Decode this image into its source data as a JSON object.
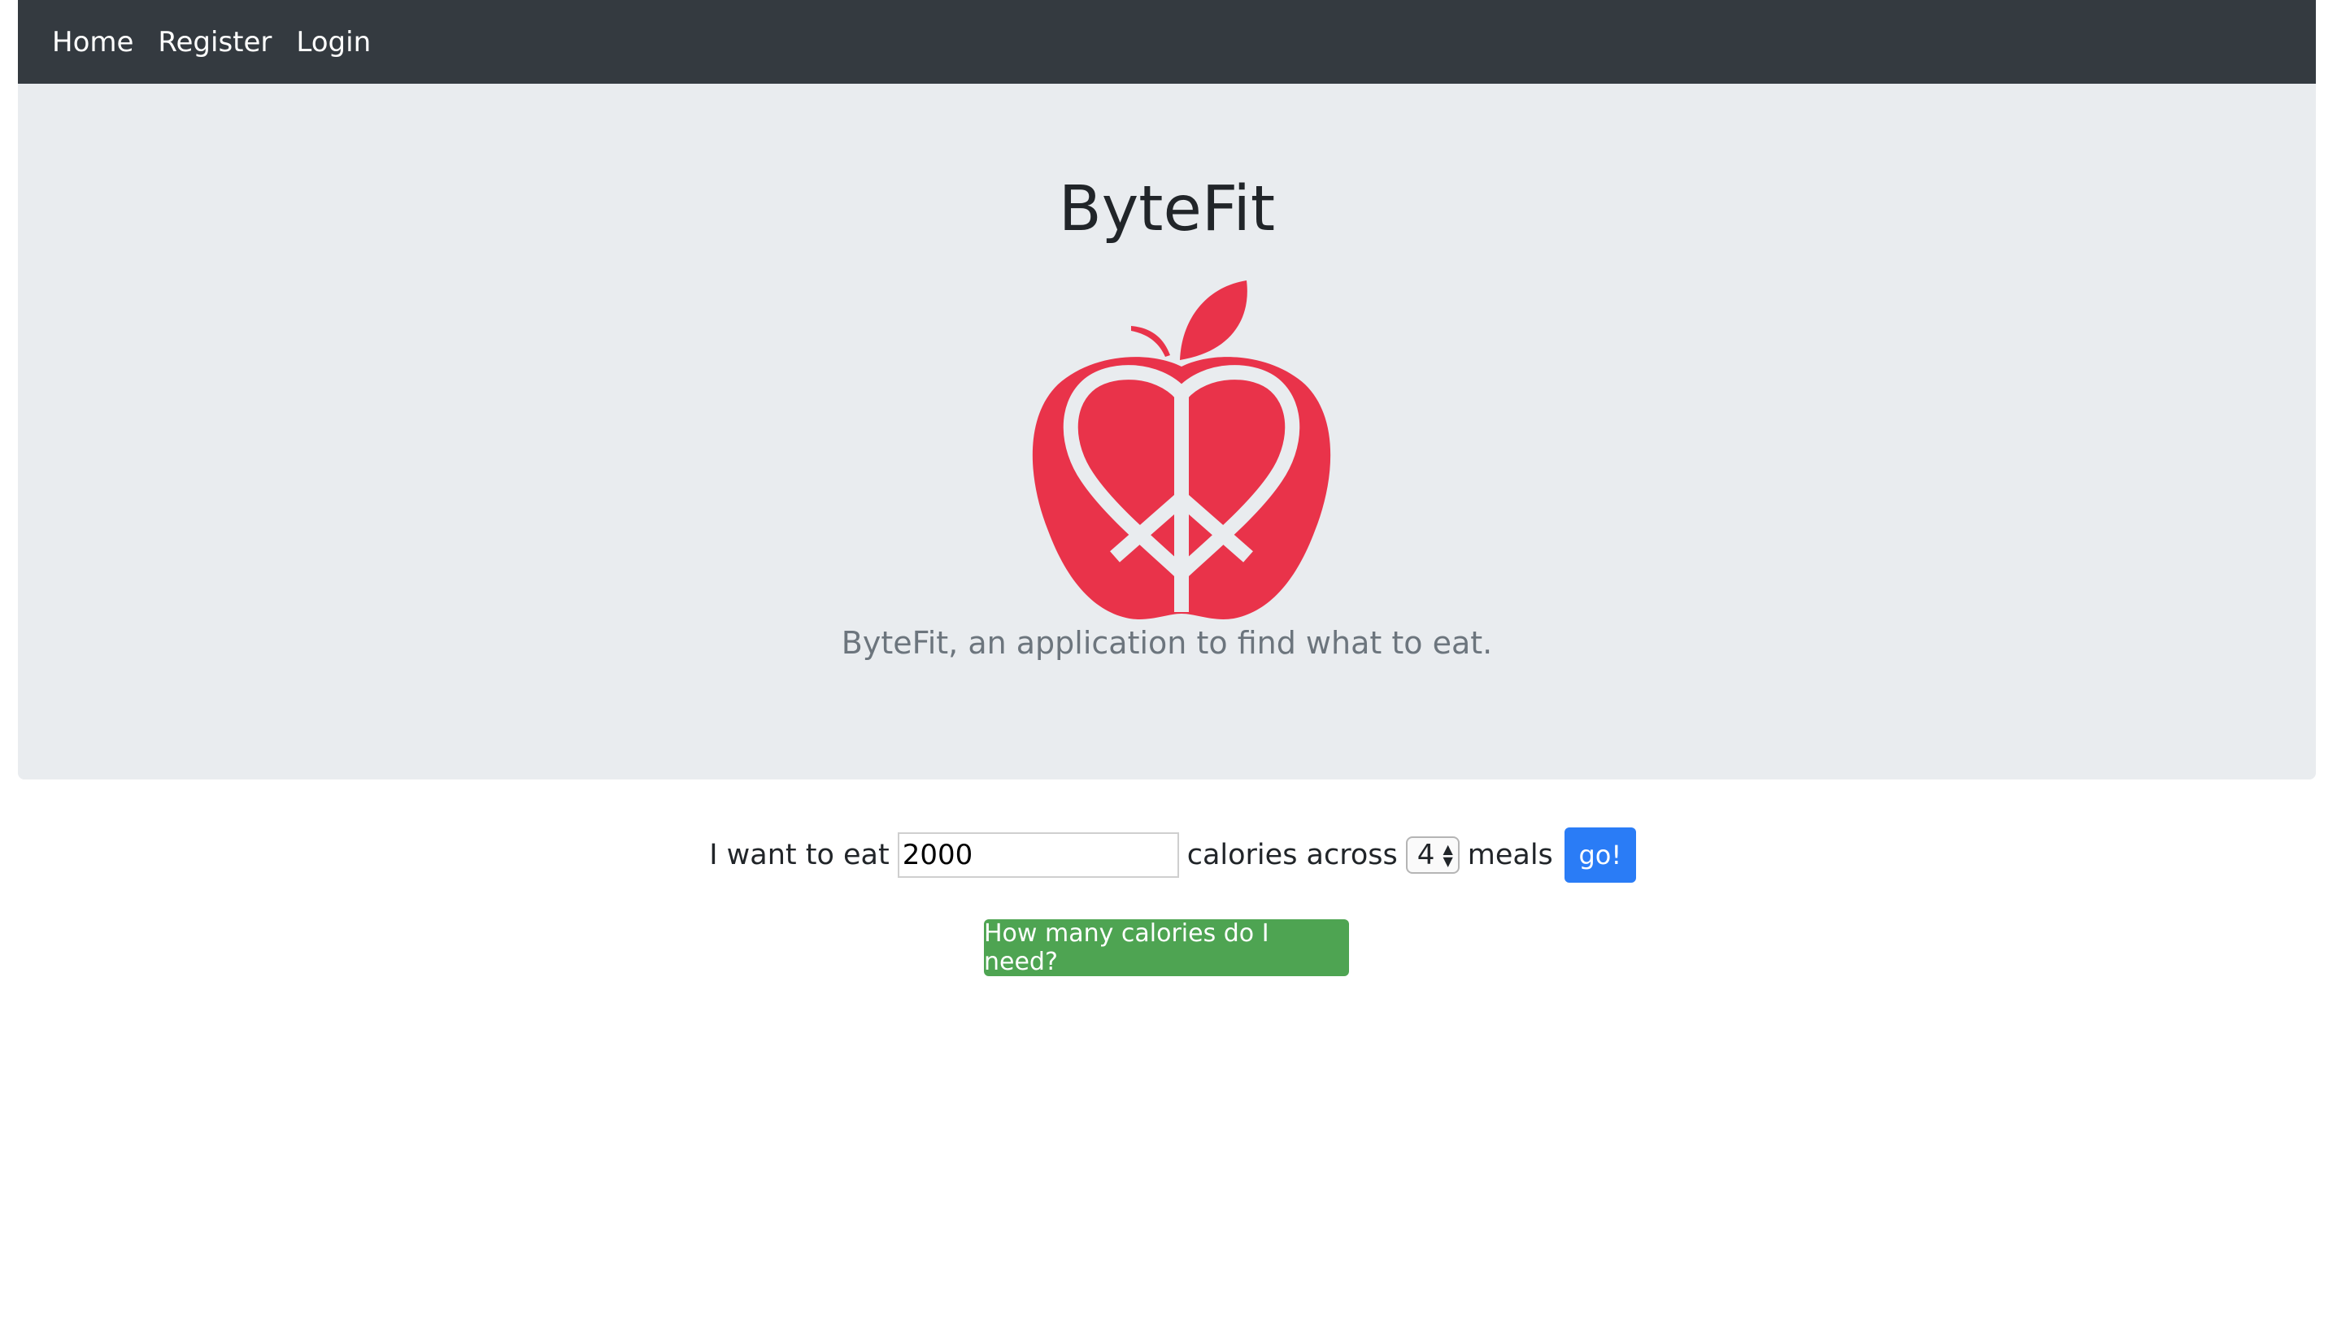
{
  "nav": {
    "items": [
      "Home",
      "Register",
      "Login"
    ]
  },
  "hero": {
    "title": "ByteFit",
    "tagline": "ByteFit, an application to find what to eat.",
    "logo_icon": "apple-peace-heart-icon"
  },
  "form": {
    "prefix": "I want to eat",
    "calories_value": "2000",
    "middle": "calories across",
    "meals_value": "4",
    "suffix": "meals",
    "go_label": "go!"
  },
  "calc_button": {
    "label": "How many calories do I need?"
  },
  "colors": {
    "navbar": "#343a40",
    "jumbotron": "#e9ecef",
    "logo_red": "#e9334a",
    "go_blue": "#2a7cf6",
    "calc_green": "#4ea452"
  }
}
